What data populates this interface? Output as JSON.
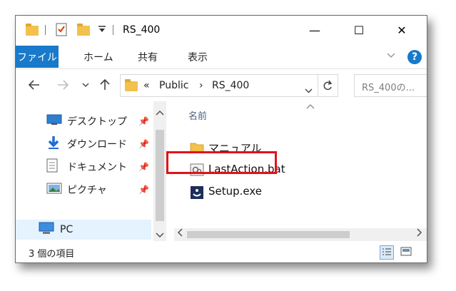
{
  "window": {
    "title": "RS_400",
    "controls": {
      "minimize": "—",
      "maximize": "☐",
      "close": "✕"
    }
  },
  "ribbon": {
    "tabs": [
      {
        "label": "ファイル",
        "active": true
      },
      {
        "label": "ホーム"
      },
      {
        "label": "共有"
      },
      {
        "label": "表示"
      }
    ],
    "help": "?"
  },
  "address": {
    "breadcrumb": [
      "«",
      "Public",
      "›",
      "RS_400"
    ],
    "search_placeholder": "RS_400の..."
  },
  "navpane": {
    "items": [
      {
        "label": "デスクトップ",
        "icon": "desktop-icon",
        "pinned": true
      },
      {
        "label": "ダウンロード",
        "icon": "download-icon",
        "pinned": true
      },
      {
        "label": "ドキュメント",
        "icon": "document-icon",
        "pinned": true
      },
      {
        "label": "ピクチャ",
        "icon": "pictures-icon",
        "pinned": true
      },
      {
        "label": "PC",
        "icon": "pc-icon",
        "selected": true
      }
    ]
  },
  "content": {
    "column_header": "名前",
    "files": [
      {
        "name": "マニュアル",
        "icon": "folder-icon"
      },
      {
        "name": "LastAction.bat",
        "icon": "bat-file-icon",
        "highlighted": true
      },
      {
        "name": "Setup.exe",
        "icon": "setup-exe-icon"
      }
    ]
  },
  "status": {
    "item_count": "3 個の項目"
  },
  "colors": {
    "accent": "#1979ca",
    "highlight": "#e1121b",
    "folder": "#f2c14e"
  }
}
